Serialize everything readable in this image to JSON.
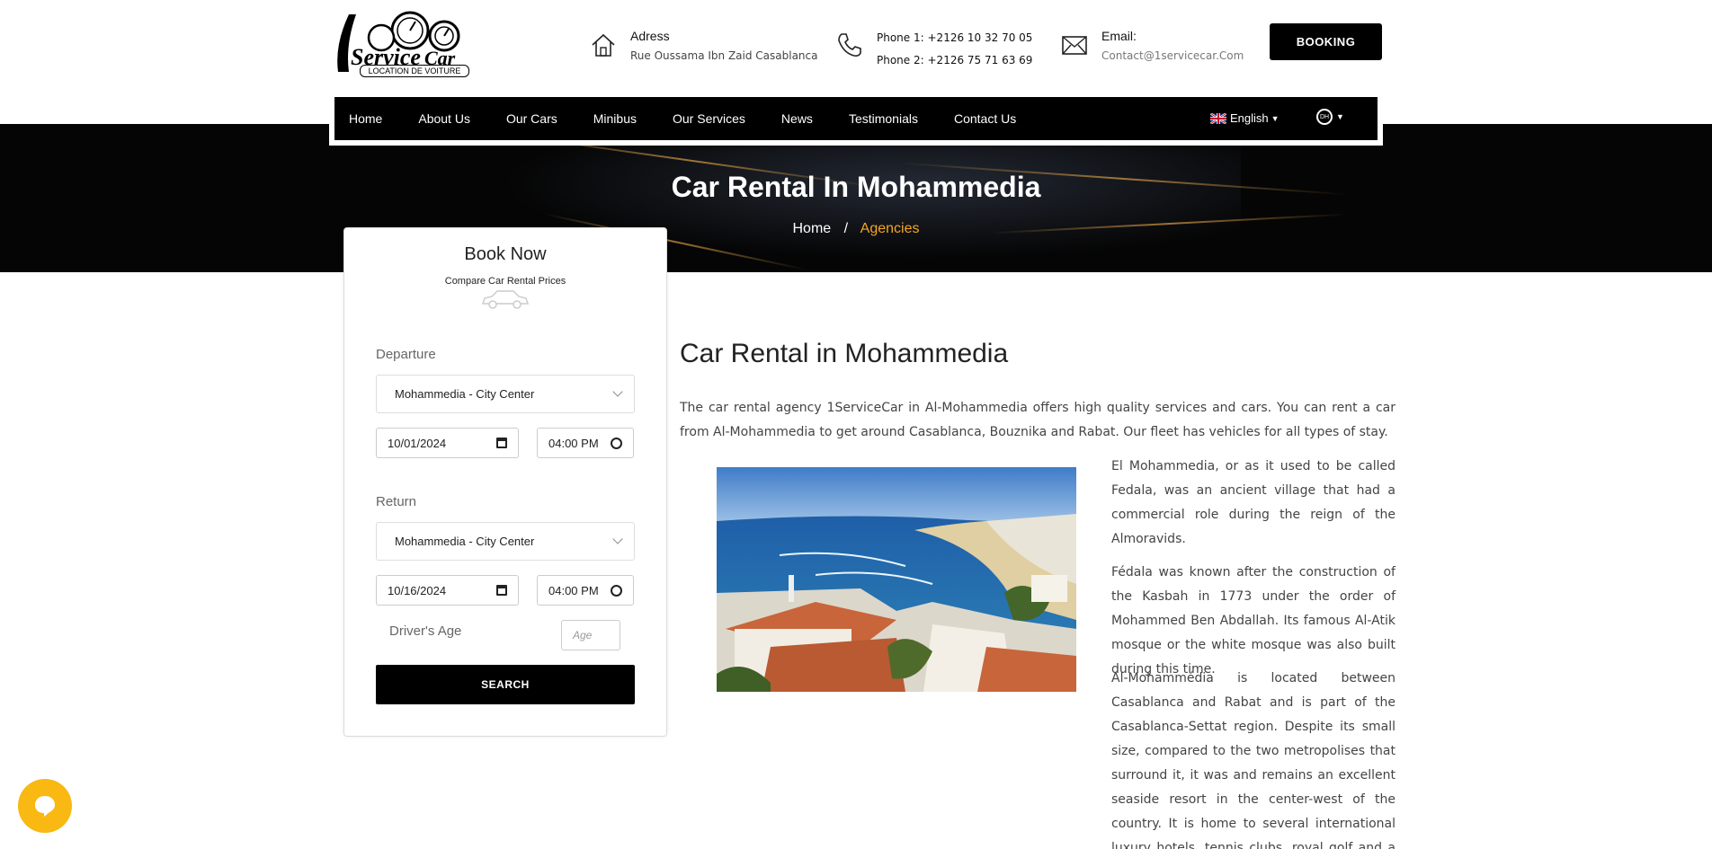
{
  "header": {
    "logo_text": "1Service Car",
    "logo_caption": "LOCATION DE VOITURE",
    "address_label": "Adress",
    "address_value": "Rue Oussama Ibn Zaid Casablanca",
    "phone1_label": "Phone 1:",
    "phone1_value": "+2126 10 32 70 05",
    "phone2_label": "Phone 2:",
    "phone2_value": "+2126 75 71 63 69",
    "email_label": "Email:",
    "email_value": "Contact@1servicecar.Com",
    "booking_label": "BOOKING"
  },
  "nav": {
    "items": [
      "Home",
      "About Us",
      "Our Cars",
      "Minibus",
      "Our Services",
      "News",
      "Testimonials",
      "Contact Us"
    ],
    "language": "English",
    "currency": "DH"
  },
  "hero": {
    "title": "Car Rental In Mohammedia",
    "breadcrumb_home": "Home",
    "breadcrumb_sep": "/",
    "breadcrumb_current": "Agencies"
  },
  "booking": {
    "title": "Book Now",
    "subtitle": "Compare Car Rental Prices",
    "departure_label": "Departure",
    "departure_location": "Mohammedia - City Center",
    "departure_date": "10/01/2024",
    "departure_time": "04:00 PM",
    "return_label": "Return",
    "return_location": "Mohammedia - City Center",
    "return_date": "10/16/2024",
    "return_time": "04:00 PM",
    "age_label": "Driver's Age",
    "age_placeholder": "Age",
    "search_label": "SEARCH"
  },
  "content": {
    "title": "Car Rental in Mohammedia",
    "intro": "The car rental agency 1ServiceCar in Al-Mohammedia offers high quality services and cars. You can rent a car from Al-Mohammedia to get around Casablanca, Bouznika and Rabat. Our fleet has vehicles for all types of stay.",
    "p1": "El Mohammedia, or as it used to be called Fedala, was an ancient village that had a commercial role during the reign of the Almoravids.",
    "p2": "Fédala was known after the construction of the Kasbah in 1773 under the order of Mohammed Ben Abdallah. Its famous Al-Atik mosque or the white mosque was also built during this time.",
    "p3": "Al-Mohammédia is located between Casablanca and Rabat and is part of the Casablanca-Settat region. Despite its small size, compared to the two metropolises that surround it, it was and remains an excellent seaside resort in the center-west of the country. It is home to several international luxury hotels, tennis clubs, royal golf and a marina."
  },
  "icons": {
    "address": "home-icon",
    "phone": "phone-icon",
    "email": "envelope-icon",
    "chat": "chat-icon"
  },
  "colors": {
    "accent": "#f4a623",
    "chat_bubble": "#f9b812",
    "nav_bg": "#000000"
  }
}
